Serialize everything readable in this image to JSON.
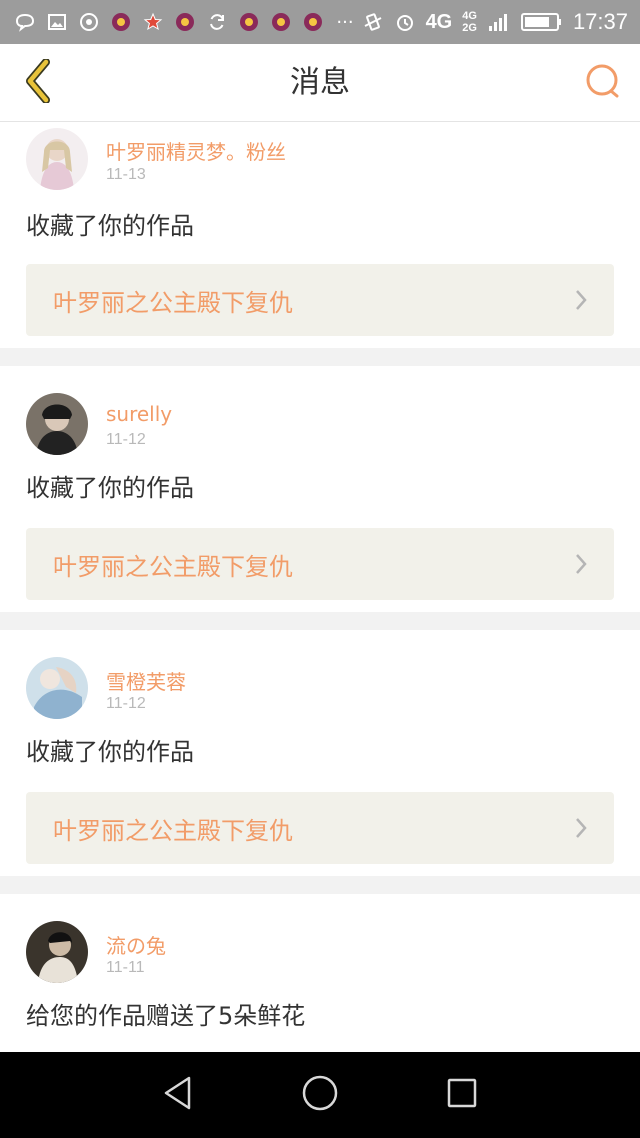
{
  "status_bar": {
    "time": "17:37",
    "network_main": "4G",
    "network_secondary_top": "4G",
    "network_secondary_bottom": "2G",
    "more": "···"
  },
  "header": {
    "title": "消息",
    "back_icon": "chevron-left-icon",
    "search_icon": "search-icon"
  },
  "colors": {
    "accent": "#f29c68",
    "header_bg": "#ffffff",
    "status_bar_bg": "#9c9c9c",
    "link_bg": "#f2f1ea",
    "back_icon": "#c9a52a"
  },
  "messages": [
    {
      "user": "叶罗丽精灵梦。粉丝",
      "date": "11-13",
      "action": "收藏了你的作品",
      "work": "叶罗丽之公主殿下复仇"
    },
    {
      "user": "surelly",
      "date": "11-12",
      "action": "收藏了你的作品",
      "work": "叶罗丽之公主殿下复仇"
    },
    {
      "user": "雪橙芙蓉",
      "date": "11-12",
      "action": "收藏了你的作品",
      "work": "叶罗丽之公主殿下复仇"
    },
    {
      "user": "流の兔",
      "date": "11-11",
      "action": "给您的作品赠送了5朵鲜花"
    }
  ]
}
